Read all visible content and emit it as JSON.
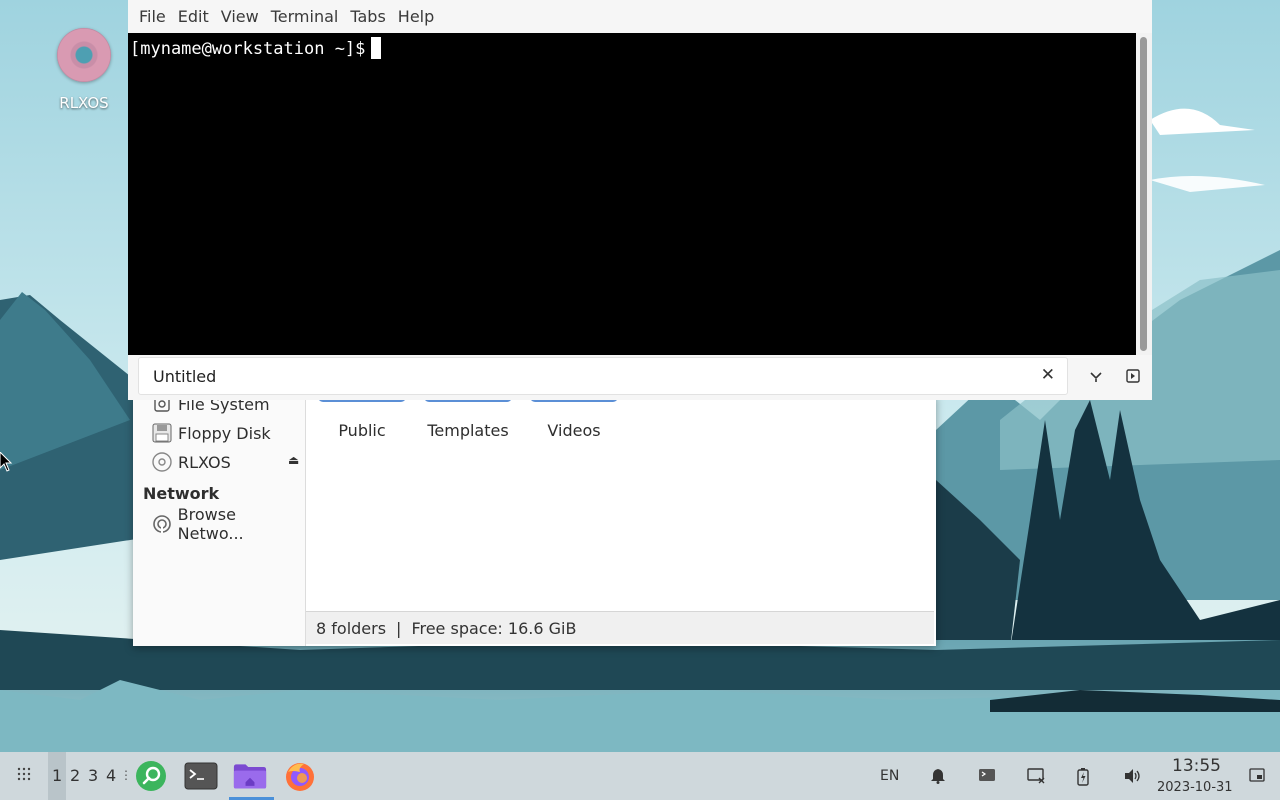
{
  "desktop": {
    "icon_label": "RLXOS"
  },
  "terminal": {
    "menu": [
      "File",
      "Edit",
      "View",
      "Terminal",
      "Tabs",
      "Help"
    ],
    "prompt": "[myname@workstation ~]$",
    "tab_title": "Untitled"
  },
  "file_manager": {
    "sidebar": {
      "devices": [
        "File System",
        "Floppy Disk",
        "RLXOS"
      ],
      "network_heading": "Network",
      "network_items": [
        "Browse Netwo..."
      ]
    },
    "folders": [
      "Public",
      "Templates",
      "Videos"
    ],
    "status": {
      "folder_count": "8 folders",
      "separator": "|",
      "free_space": "Free space: 16.6 GiB"
    }
  },
  "taskbar": {
    "workspaces": [
      "1",
      "2",
      "3",
      "4"
    ],
    "active_workspace": "1",
    "apps": [
      "search-app",
      "terminal-app",
      "file-manager-app",
      "firefox-app"
    ],
    "language": "EN",
    "clock_time": "13:55",
    "clock_date": "2023-10-31"
  },
  "colors": {
    "accent": "#4a90d9",
    "terminal_bg": "#000000",
    "taskbar_bg": "#cfd8dc"
  }
}
